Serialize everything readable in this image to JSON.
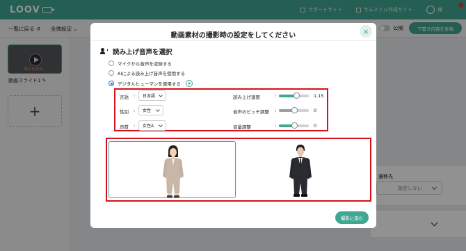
{
  "topbar": {
    "logo": "LOOV",
    "links": [
      "サポートサイト",
      "サムネイル作成サイト"
    ],
    "user_name": "様"
  },
  "toolbar": {
    "back_label": "一覧に戻る ↺",
    "settings_label": "全体設定 ⌄",
    "public_label": "公開",
    "publish_label": "下書き内容を反映"
  },
  "sidebar": {
    "slide_caption": "撮影を追加",
    "slide_name": "動画スライド1 ✎",
    "add_symbol": "+"
  },
  "right_panel": {
    "label": "遷移先",
    "select_value": "設定しない"
  },
  "modal": {
    "title": "動画素材の撮影時の設定をしてください",
    "close_symbol": "×",
    "section_title": "読み上げ音声を選択",
    "radio_options": [
      {
        "label": "マイクから音声を収録する",
        "selected": false
      },
      {
        "label": "AIによる読み上げ音声を使用する",
        "selected": false
      },
      {
        "label": "デジタルヒューマンを使用する",
        "selected": true
      }
    ],
    "settings": {
      "language": {
        "label": "言語",
        "value": "日本語"
      },
      "gender": {
        "label": "性別",
        "value": "女性"
      },
      "voice": {
        "label": "声質",
        "value": "女性A"
      },
      "speed": {
        "label": "読み上げ速度",
        "value": "1.15",
        "fraction": 0.57,
        "color": "#41a692"
      },
      "pitch": {
        "label": "音声のピッチ調整",
        "value": "0",
        "fraction": 0.5,
        "color": "#9aa0a6"
      },
      "volume": {
        "label": "音量調整",
        "value": "0",
        "fraction": 0.5,
        "color": "#41a692"
      }
    },
    "colon": ":",
    "avatars": [
      {
        "name": "female-avatar",
        "selected": true
      },
      {
        "name": "male-avatar",
        "selected": false
      }
    ],
    "next_button": "撮影に進む"
  },
  "colors": {
    "accent": "#41a692",
    "highlight_red": "#d4111c",
    "radio_blue": "#1a6fd8"
  }
}
